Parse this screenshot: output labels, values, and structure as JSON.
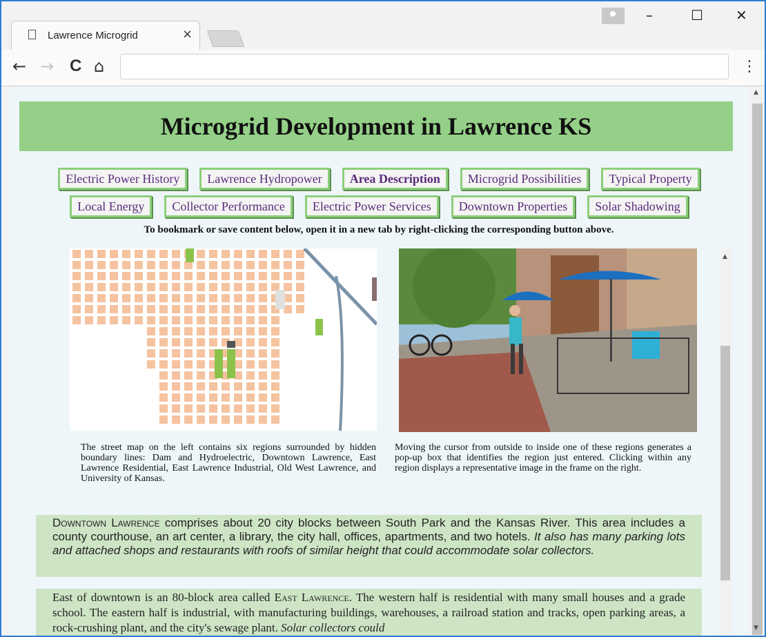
{
  "browser": {
    "tab_title": "Lawrence Microgrid",
    "tab_close": "×",
    "window_minimize": "–",
    "window_maximize": "☐",
    "window_close": "✕",
    "nav_back": "←",
    "nav_forward": "→",
    "nav_reload": "C",
    "nav_home": "⌂",
    "menu": "⋮",
    "address_value": ""
  },
  "page": {
    "title": "Microgrid Development in Lawrence KS",
    "nav_row1": [
      "Electric Power History",
      "Lawrence Hydropower",
      "Area Description",
      "Microgrid Possibilities",
      "Typical Property"
    ],
    "nav_row2": [
      "Local Energy",
      "Collector Performance",
      "Electric Power Services",
      "Downtown Properties",
      "Solar Shadowing"
    ],
    "active_nav": "Area Description",
    "instructions": "To bookmark or save content below, open it in a new tab by right-clicking the corresponding button above.",
    "caption_left": "The street map on the left contains six regions surrounded by hidden boundary lines: Dam and Hydroelectric, Downtown Lawrence, East Lawrence Residential, East Lawrence Industrial, Old West Lawrence, and University of Kansas.",
    "caption_right": "Moving the cursor from outside to inside one of these regions generates a pop-up box that identifies the region just entered. Clicking within any region displays a representative image in the frame on the right.",
    "para1": {
      "lead": "Downtown Lawrence",
      "text": " comprises about 20 city blocks between South Park and the Kansas River. This area includes a county courthouse, an art center, a library, the city hall, offices, apartments, and two hotels. ",
      "italic": "It also has many parking lots and attached shops and restaurants with roofs of similar height that could accommodate solar collectors."
    },
    "para2": {
      "pre": "East of downtown is an 80-block area called ",
      "lead": "East Lawrence",
      "text": ". The western half is residential with many small houses and a grade school. The eastern half is industrial, with manufacturing buildings, warehouses, a railroad station and tracks, open parking areas, a rock-crushing plant, and the city's sewage plant. ",
      "italic": "Solar collectors could"
    }
  },
  "colors": {
    "banner": "#95d088",
    "paragraph_bg": "#cde5c5",
    "page_bg": "#eef6fa",
    "nav_border": "#8ccf7a",
    "nav_text": "#5a2a7a",
    "map_block": "#f5c3a0",
    "map_park": "#8bc34a",
    "map_river": "#7a93a8"
  }
}
